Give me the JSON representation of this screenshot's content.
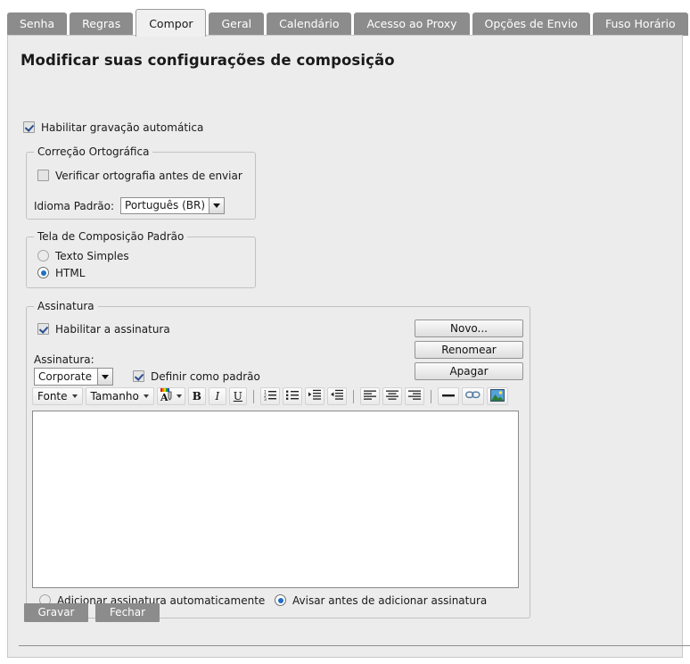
{
  "tabs": [
    {
      "label": "Senha",
      "active": false
    },
    {
      "label": "Regras",
      "active": false
    },
    {
      "label": "Compor",
      "active": true
    },
    {
      "label": "Geral",
      "active": false
    },
    {
      "label": "Calendário",
      "active": false
    },
    {
      "label": "Acesso ao Proxy",
      "active": false
    },
    {
      "label": "Opções de Envio",
      "active": false
    },
    {
      "label": "Fuso Horário",
      "active": false
    }
  ],
  "page": {
    "title": "Modificar suas configurações de composição"
  },
  "autosave": {
    "label": "Habilitar gravação automática",
    "checked": true
  },
  "spellcheck": {
    "legend": "Correção Ortográfica",
    "check_label": "Verificar ortografia antes de enviar",
    "check_checked": false,
    "language_label": "Idioma Padrão:",
    "language_value": "Português (BR)"
  },
  "compose_screen": {
    "legend": "Tela de Composição Padrão",
    "options": [
      {
        "label": "Texto Simples",
        "selected": false
      },
      {
        "label": "HTML",
        "selected": true
      }
    ]
  },
  "signature": {
    "legend": "Assinatura",
    "enable_label": "Habilitar a assinatura",
    "enable_checked": true,
    "select_label": "Assinatura:",
    "select_value": "Corporate",
    "default_label": "Definir como padrão",
    "default_checked": true,
    "buttons": [
      {
        "label": "Novo...",
        "name": "new-signature-button"
      },
      {
        "label": "Renomear",
        "name": "rename-signature-button"
      },
      {
        "label": "Apagar",
        "name": "delete-signature-button"
      }
    ],
    "editor_content": "",
    "radios": [
      {
        "label": "Adicionar assinatura automaticamente",
        "selected": false
      },
      {
        "label": "Avisar antes de adicionar assinatura",
        "selected": true
      }
    ]
  },
  "toolbar": {
    "font_label": "Fonte",
    "size_label": "Tamanho",
    "color_label": "Cor do texto",
    "bold_label": "B",
    "italic_label": "I",
    "underline_label": "U",
    "ordered_list_label": "Lista numerada",
    "unordered_list_label": "Lista com marcadores",
    "indent_label": "Aumentar recuo",
    "outdent_label": "Diminuir recuo",
    "align_left_label": "Alinhar à esquerda",
    "align_center_label": "Centralizar",
    "align_right_label": "Alinhar à direita",
    "hrule_label": "Linha horizontal",
    "link_label": "Inserir link",
    "image_label": "Inserir imagem"
  },
  "footer": {
    "save_label": "Gravar",
    "close_label": "Fechar"
  },
  "colors": {
    "tab_inactive_bg": "#8c8c8c",
    "tab_active_bg": "#f0f0f0",
    "panel_bg": "#ececed",
    "button_bg": "#8c8c8c",
    "radio_accent": "#1f6fc4",
    "check_accent": "#2a4d8f"
  }
}
